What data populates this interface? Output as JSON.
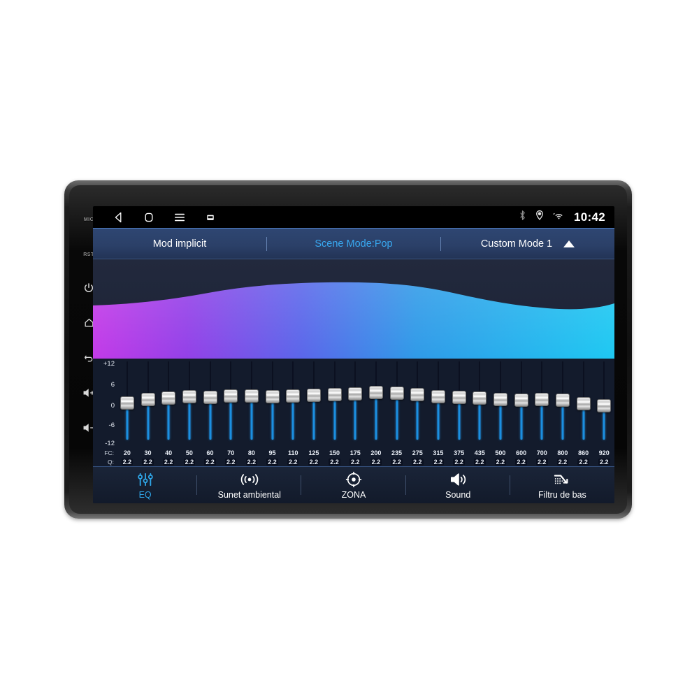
{
  "device": {
    "side_keys": [
      {
        "name": "mic",
        "label": "MIC",
        "type": "text"
      },
      {
        "name": "reset",
        "label": "RST",
        "type": "text"
      },
      {
        "name": "power",
        "label": "",
        "type": "icon"
      },
      {
        "name": "home",
        "label": "",
        "type": "icon"
      },
      {
        "name": "back",
        "label": "",
        "type": "icon"
      },
      {
        "name": "volume-up",
        "label": "",
        "type": "icon"
      },
      {
        "name": "volume-down",
        "label": "",
        "type": "icon"
      }
    ]
  },
  "statusbar": {
    "back_icon": "back-triangle-icon",
    "home_icon": "home-square-icon",
    "menu_icon": "hamburger-menu-icon",
    "apps_icon": "recent-apps-icon",
    "bluetooth_icon": "bluetooth-icon",
    "location_icon": "location-pin-icon",
    "wifi_icon": "wifi-icon",
    "clock": "10:42"
  },
  "modebar": {
    "default_mode": "Mod implicit",
    "scene_mode": "Scene Mode:Pop",
    "custom_mode": "Custom Mode 1",
    "expand_icon": "triangle-up-icon",
    "active_color": "#38a8f0"
  },
  "curve": {
    "gradient_from": "#b23ce0",
    "gradient_to": "#1fc3f0",
    "background": "#22293d"
  },
  "eq": {
    "scale_labels": [
      "+12",
      "6",
      "0",
      "-6",
      "-12"
    ],
    "scale_min": -12,
    "scale_max": 12,
    "fc_row_label": "FC:",
    "q_row_label": "Q:",
    "track_color": "#1b8fe0",
    "bands": [
      {
        "fc": "20",
        "q": "2.2",
        "gain": -0.4
      },
      {
        "fc": "30",
        "q": "2.2",
        "gain": 0.6
      },
      {
        "fc": "40",
        "q": "2.2",
        "gain": 1.2
      },
      {
        "fc": "50",
        "q": "2.2",
        "gain": 1.7
      },
      {
        "fc": "60",
        "q": "2.2",
        "gain": 1.5
      },
      {
        "fc": "70",
        "q": "2.2",
        "gain": 1.9
      },
      {
        "fc": "80",
        "q": "2.2",
        "gain": 1.8
      },
      {
        "fc": "95",
        "q": "2.2",
        "gain": 1.7
      },
      {
        "fc": "110",
        "q": "2.2",
        "gain": 1.9
      },
      {
        "fc": "125",
        "q": "2.2",
        "gain": 2.0
      },
      {
        "fc": "150",
        "q": "2.2",
        "gain": 2.4
      },
      {
        "fc": "175",
        "q": "2.2",
        "gain": 2.6
      },
      {
        "fc": "200",
        "q": "2.2",
        "gain": 3.1
      },
      {
        "fc": "235",
        "q": "2.2",
        "gain": 2.8
      },
      {
        "fc": "275",
        "q": "2.2",
        "gain": 2.3
      },
      {
        "fc": "315",
        "q": "2.2",
        "gain": 1.6
      },
      {
        "fc": "375",
        "q": "2.2",
        "gain": 1.4
      },
      {
        "fc": "435",
        "q": "2.2",
        "gain": 1.2
      },
      {
        "fc": "500",
        "q": "2.2",
        "gain": 0.6
      },
      {
        "fc": "600",
        "q": "2.2",
        "gain": 0.5
      },
      {
        "fc": "700",
        "q": "2.2",
        "gain": 0.6
      },
      {
        "fc": "800",
        "q": "2.2",
        "gain": 0.5
      },
      {
        "fc": "860",
        "q": "2.2",
        "gain": -0.6
      },
      {
        "fc": "920",
        "q": "2.2",
        "gain": -1.4
      }
    ]
  },
  "bottomnav": {
    "items": [
      {
        "label": "EQ",
        "icon": "equalizer-icon",
        "active": true
      },
      {
        "label": "Sunet ambiental",
        "icon": "surround-icon",
        "active": false
      },
      {
        "label": "ZONA",
        "icon": "zone-target-icon",
        "active": false
      },
      {
        "label": "Sound",
        "icon": "speaker-icon",
        "active": false
      },
      {
        "label": "Filtru de bas",
        "icon": "bass-filter-icon",
        "active": false
      }
    ],
    "active_color": "#2fa7ea"
  }
}
